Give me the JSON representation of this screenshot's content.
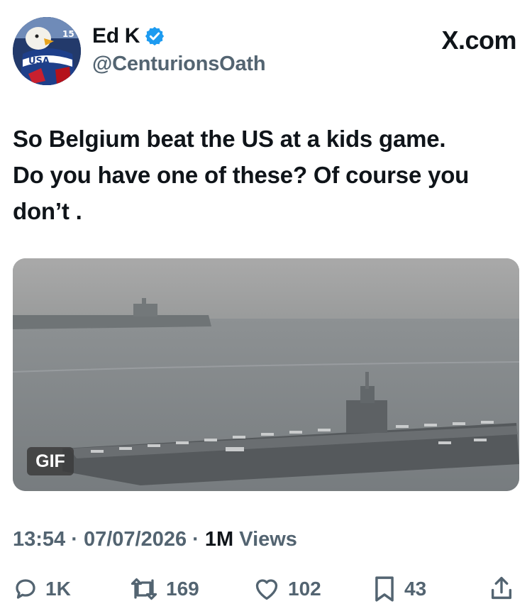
{
  "user": {
    "display_name": "Ed K",
    "handle": "@CenturionsOath",
    "verified": true,
    "verified_color": "#1d9bf0",
    "avatar_icon": "usa-hockey-eagle-avatar"
  },
  "brand": {
    "label": "X.com"
  },
  "post": {
    "lines": [
      "So Belgium beat the US at a kids game.",
      "Do you have one of these?  Of course you",
      "don’t ."
    ]
  },
  "media": {
    "badge": "GIF"
  },
  "meta": {
    "time": "13:54",
    "sep1": " · ",
    "date": "07/07/2026",
    "sep2": " · ",
    "views_count": "1M",
    "views_label": " Views"
  },
  "actions": {
    "replies": "1K",
    "reposts": "169",
    "likes": "102",
    "bookmarks": "43"
  },
  "colors": {
    "text": "#0f1419",
    "secondary": "#536471",
    "accent": "#1d9bf0"
  }
}
